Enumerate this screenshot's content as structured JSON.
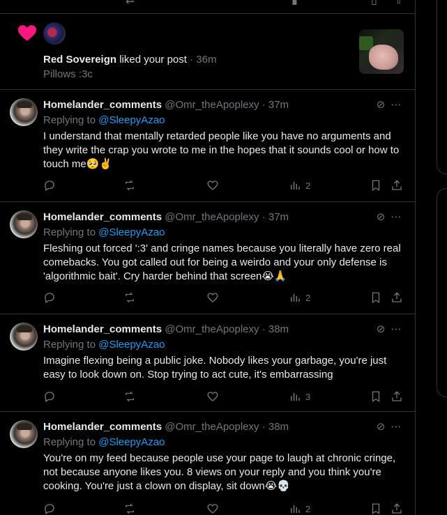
{
  "notification": {
    "liker_name": "Red Sovereign",
    "action_text": "liked your post",
    "time": "· 36m",
    "post_preview": "Pillows :3c"
  },
  "replies": [
    {
      "name": "Homelander_comments",
      "handle": "@Omr_theApoplexy",
      "time": "· 37m",
      "replying_prefix": "Replying to",
      "replying_to": "@SleepyAzao",
      "text": "I understand that mentally retarded people like you have no arguments and they write the crap you wrote to me in the hopes that it sounds cool or how to touch me🥺✌️",
      "views": "2"
    },
    {
      "name": "Homelander_comments",
      "handle": "@Omr_theApoplexy",
      "time": "· 37m",
      "replying_prefix": "Replying to",
      "replying_to": "@SleepyAzao",
      "text": "Fleshing out forced ':3' and cringe names because you literally have zero real comebacks. You got called out for being a weirdo and your only defense is 'algorithmic bait'. Cry harder behind that screen😭🙏",
      "views": "2"
    },
    {
      "name": "Homelander_comments",
      "handle": "@Omr_theApoplexy",
      "time": "· 38m",
      "replying_prefix": "Replying to",
      "replying_to": "@SleepyAzao",
      "text": "Imagine flexing being a public joke. Nobody likes your garbage, you're just easy to look down on. Stop trying to act cute, it's embarrassing",
      "views": "3"
    },
    {
      "name": "Homelander_comments",
      "handle": "@Omr_theApoplexy",
      "time": "· 38m",
      "replying_prefix": "Replying to",
      "replying_to": "@SleepyAzao",
      "text": "You're on my feed because people use your page to laugh at chronic cringe, not because anyone likes you. 8 views on your reply and you think you're cooking. You're just a clown on display, sit down😭💀",
      "views": "2"
    }
  ],
  "colors": {
    "background": "#000000",
    "text": "#e7e9ea",
    "muted": "#71767b",
    "link": "#1d9bf0",
    "heart": "#f91880",
    "border": "#2f3336"
  }
}
